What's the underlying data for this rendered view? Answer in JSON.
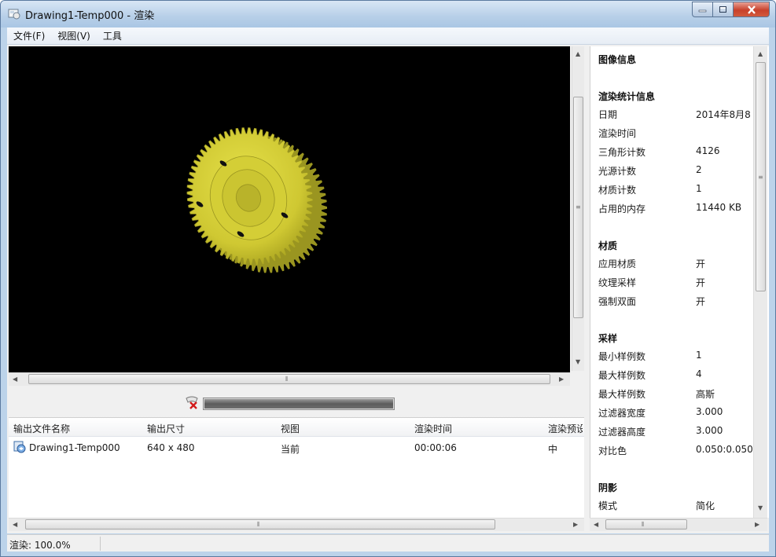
{
  "window": {
    "title": "Drawing1-Temp000 - 渲染"
  },
  "menu": {
    "items": [
      "文件(F)",
      "视图(V)",
      "工具"
    ]
  },
  "render": {
    "progress_percent": 100
  },
  "output_list": {
    "columns": [
      "输出文件名称",
      "输出尺寸",
      "视图",
      "渲染时间",
      "渲染预设"
    ],
    "rows": [
      {
        "name": "Drawing1-Temp000",
        "size": "640 x 480",
        "view": "当前",
        "time": "00:00:06",
        "preset": "中"
      }
    ]
  },
  "info": {
    "header": "图像信息",
    "sections": [
      {
        "title": "渲染统计信息",
        "rows": [
          {
            "label": "日期",
            "value": "2014年8月8"
          },
          {
            "label": "渲染时间",
            "value": ""
          },
          {
            "label": "三角形计数",
            "value": "4126"
          },
          {
            "label": "光源计数",
            "value": "2"
          },
          {
            "label": "材质计数",
            "value": "1"
          },
          {
            "label": "占用的内存",
            "value": "11440 KB"
          }
        ]
      },
      {
        "title": "材质",
        "rows": [
          {
            "label": "应用材质",
            "value": "开"
          },
          {
            "label": "纹理采样",
            "value": "开"
          },
          {
            "label": "强制双面",
            "value": "开"
          }
        ]
      },
      {
        "title": "采样",
        "rows": [
          {
            "label": "最小样例数",
            "value": "1"
          },
          {
            "label": "最大样例数",
            "value": "4"
          },
          {
            "label": "最大样例数",
            "value": "高斯"
          },
          {
            "label": "过滤器宽度",
            "value": "3.000"
          },
          {
            "label": "过滤器高度",
            "value": "3.000"
          },
          {
            "label": "对比色",
            "value": "0.050:0.050"
          }
        ]
      },
      {
        "title": "阴影",
        "rows": [
          {
            "label": "模式",
            "value": "简化"
          }
        ]
      }
    ]
  },
  "status": {
    "text": "渲染: 100.0%"
  },
  "colors": {
    "gear": "#d8d23a",
    "gear_dark": "#9a9520",
    "render_bg": "#000000"
  }
}
